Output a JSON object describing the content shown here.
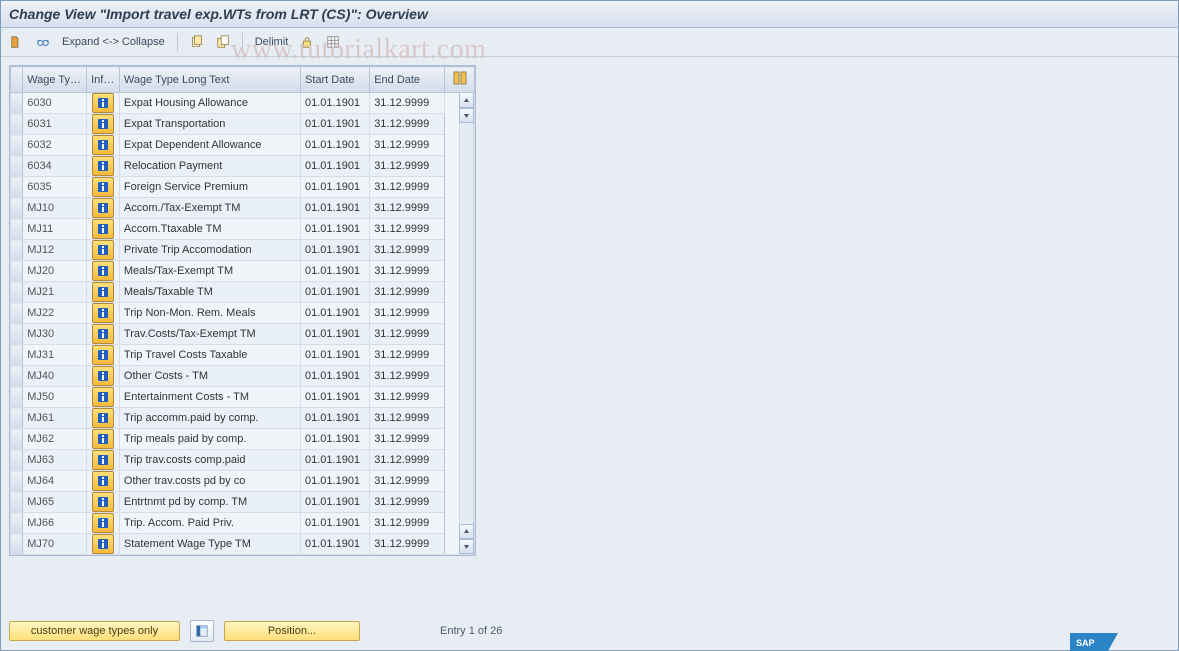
{
  "title": "Change View \"Import travel exp.WTs from LRT (CS)\": Overview",
  "watermark": "www.tutorialkart.com",
  "toolbar": {
    "expand": "Expand <-> Collapse",
    "delimit": "Delimit"
  },
  "table": {
    "headers": {
      "code": "Wage Ty…",
      "info": "Inf…",
      "long": "Wage Type Long Text",
      "start": "Start Date",
      "end": "End Date"
    },
    "rows": [
      {
        "code": "6030",
        "long": "Expat Housing Allowance",
        "start": "01.01.1901",
        "end": "31.12.9999"
      },
      {
        "code": "6031",
        "long": "Expat Transportation",
        "start": "01.01.1901",
        "end": "31.12.9999"
      },
      {
        "code": "6032",
        "long": "Expat Dependent Allowance",
        "start": "01.01.1901",
        "end": "31.12.9999"
      },
      {
        "code": "6034",
        "long": "Relocation Payment",
        "start": "01.01.1901",
        "end": "31.12.9999"
      },
      {
        "code": "6035",
        "long": "Foreign Service Premium",
        "start": "01.01.1901",
        "end": "31.12.9999"
      },
      {
        "code": "MJ10",
        "long": "Accom./Tax-Exempt TM",
        "start": "01.01.1901",
        "end": "31.12.9999"
      },
      {
        "code": "MJ11",
        "long": "Accom.Ttaxable TM",
        "start": "01.01.1901",
        "end": "31.12.9999"
      },
      {
        "code": "MJ12",
        "long": "Private Trip Accomodation",
        "start": "01.01.1901",
        "end": "31.12.9999"
      },
      {
        "code": "MJ20",
        "long": "Meals/Tax-Exempt TM",
        "start": "01.01.1901",
        "end": "31.12.9999"
      },
      {
        "code": "MJ21",
        "long": "Meals/Taxable TM",
        "start": "01.01.1901",
        "end": "31.12.9999"
      },
      {
        "code": "MJ22",
        "long": "Trip Non-Mon. Rem. Meals",
        "start": "01.01.1901",
        "end": "31.12.9999"
      },
      {
        "code": "MJ30",
        "long": "Trav.Costs/Tax-Exempt TM",
        "start": "01.01.1901",
        "end": "31.12.9999"
      },
      {
        "code": "MJ31",
        "long": "Trip Travel Costs Taxable",
        "start": "01.01.1901",
        "end": "31.12.9999"
      },
      {
        "code": "MJ40",
        "long": "Other Costs - TM",
        "start": "01.01.1901",
        "end": "31.12.9999"
      },
      {
        "code": "MJ50",
        "long": "Entertainment Costs - TM",
        "start": "01.01.1901",
        "end": "31.12.9999"
      },
      {
        "code": "MJ61",
        "long": "Trip accomm.paid by comp.",
        "start": "01.01.1901",
        "end": "31.12.9999"
      },
      {
        "code": "MJ62",
        "long": "Trip meals paid by comp.",
        "start": "01.01.1901",
        "end": "31.12.9999"
      },
      {
        "code": "MJ63",
        "long": "Trip trav.costs comp.paid",
        "start": "01.01.1901",
        "end": "31.12.9999"
      },
      {
        "code": "MJ64",
        "long": "Other trav.costs pd by co",
        "start": "01.01.1901",
        "end": "31.12.9999"
      },
      {
        "code": "MJ65",
        "long": "Entrtnmt pd by comp. TM",
        "start": "01.01.1901",
        "end": "31.12.9999"
      },
      {
        "code": "MJ66",
        "long": "Trip. Accom. Paid Priv.",
        "start": "01.01.1901",
        "end": "31.12.9999"
      },
      {
        "code": "MJ70",
        "long": "Statement Wage Type  TM",
        "start": "01.01.1901",
        "end": "31.12.9999"
      }
    ]
  },
  "footer": {
    "customer_btn": "customer wage types only",
    "position_btn": "Position...",
    "entry": "Entry 1 of 26"
  }
}
